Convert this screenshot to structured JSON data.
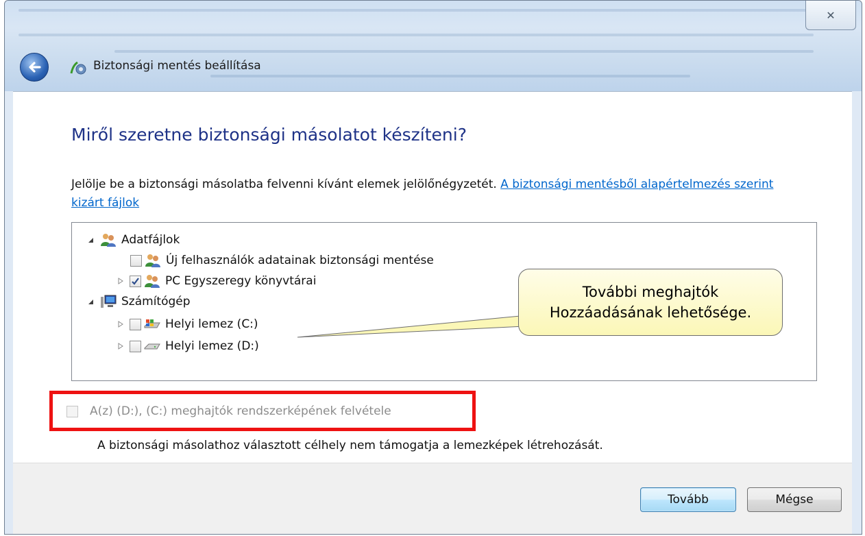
{
  "window": {
    "title": "Biztonsági mentés beállítása",
    "close_glyph": "✕"
  },
  "page": {
    "heading": "Miről szeretne biztonsági másolatot készíteni?",
    "instruction": "Jelölje be a biztonsági másolatba felvenni kívánt elemek jelölőnégyzetét.",
    "instruction_link": "A biztonsági mentésből alapértelmezés szerint kizárt fájlok"
  },
  "tree": {
    "data_files": {
      "label": "Adatfájlok",
      "expanded": true,
      "icon": "users-icon",
      "children": [
        {
          "label": "Új felhasználók adatainak biztonsági mentése",
          "checked": false,
          "icon": "users-icon"
        },
        {
          "label": "PC Egyszeregy könyvtárai",
          "checked": true,
          "icon": "users-icon"
        }
      ]
    },
    "computer": {
      "label": "Számítógép",
      "expanded": true,
      "icon": "computer-icon",
      "children": [
        {
          "label": "Helyi lemez (C:)",
          "checked": false,
          "icon": "system-drive-icon"
        },
        {
          "label": "Helyi lemez (D:)",
          "checked": false,
          "icon": "drive-icon"
        }
      ]
    }
  },
  "callout": {
    "line1": "További meghajtók",
    "line2": "Hozzáadásának lehetősége."
  },
  "system_image": {
    "label": "A(z) (D:), (C:) meghajtók rendszerképének felvétele",
    "checked": false,
    "disabled": true,
    "note": "A biztonsági másolathoz választott célhely nem támogatja a lemezképek létrehozását."
  },
  "buttons": {
    "next": "Tovább",
    "cancel": "Mégse"
  },
  "colors": {
    "heading": "#1e3287",
    "link": "#0066cc",
    "highlight_box": "#ee1212",
    "callout_fill": "#fbf7b7"
  }
}
